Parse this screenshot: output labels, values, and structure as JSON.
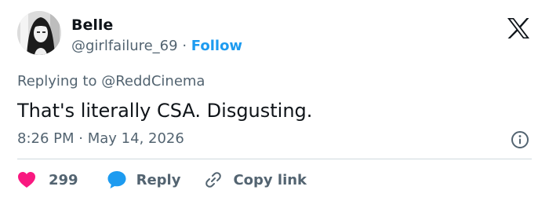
{
  "author": {
    "name": "Belle",
    "handle": "@girlfailure_69",
    "separator": "·",
    "follow_label": "Follow"
  },
  "reply_context": {
    "prefix": "Replying to",
    "mention": "@ReddCinema"
  },
  "tweet": {
    "text": "That's literally CSA. Disgusting.",
    "time": "8:26 PM",
    "separator": "·",
    "date": "May 14, 2026"
  },
  "actions": {
    "like_count": "299",
    "reply_label": "Reply",
    "copy_link_label": "Copy link"
  },
  "icons": {
    "logo": "x-logo-icon",
    "info": "info-icon",
    "like": "heart-icon",
    "reply": "speech-bubble-icon",
    "copy_link": "link-icon"
  },
  "colors": {
    "accent": "#1d9bf0",
    "like": "#f91880",
    "text": "#0f1419",
    "secondary": "#536471"
  }
}
